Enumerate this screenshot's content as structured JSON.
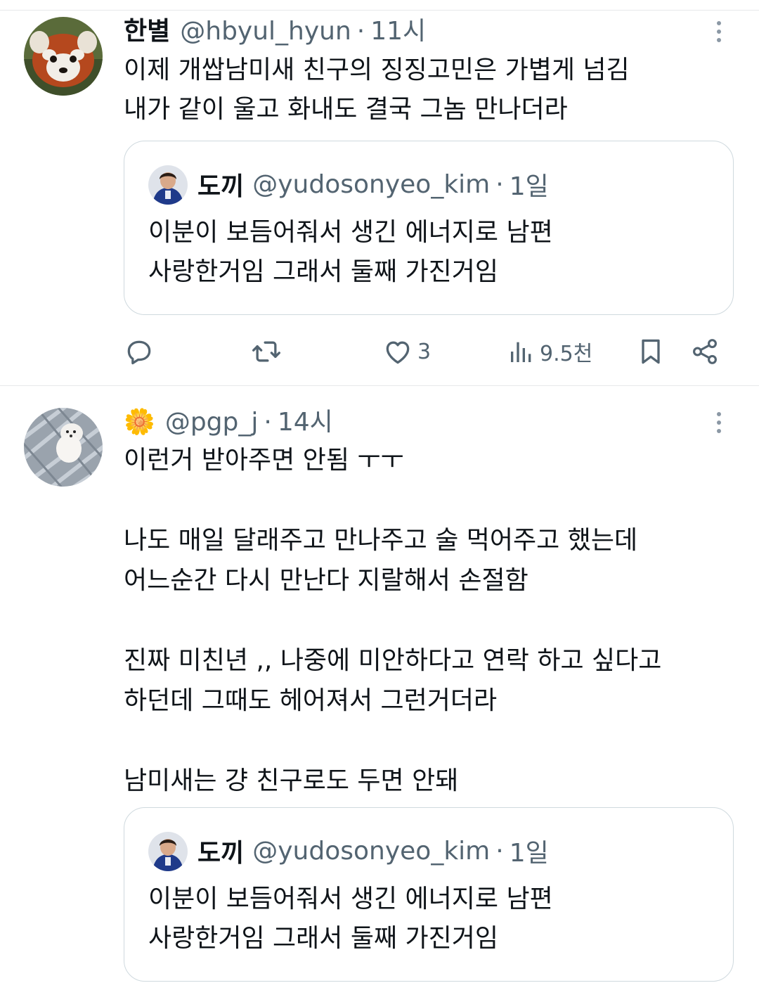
{
  "tweets": [
    {
      "display_name": "한별",
      "handle": "@hbyul_hyun",
      "separator": "·",
      "time": "11시",
      "text": "이제 개쌉남미새 친구의 징징고민은 가볍게 넘김\n내가 같이 울고 화내도 결국 그놈 만나더라",
      "quote": {
        "display_name": "도끼",
        "handle": "@yudosonyeo_kim",
        "separator": "·",
        "time": "1일",
        "text": "이분이 보듬어줘서 생긴 에너지로 남편\n사랑한거임 그래서 둘째 가진거임"
      },
      "actions": {
        "reply_icon": "reply-icon",
        "retweet_icon": "retweet-icon",
        "like_icon": "heart-icon",
        "like_count": "3",
        "views_icon": "views-icon",
        "views_count": "9.5천",
        "bookmark_icon": "bookmark-icon",
        "share_icon": "share-icon"
      }
    },
    {
      "display_name_emoji": "🌼",
      "handle": "@pgp_j",
      "separator": "·",
      "time": "14시",
      "text": "이런거 받아주면 안됨 ㅜㅜ\n\n나도 매일 달래주고 만나주고 술 먹어주고 했는데\n어느순간 다시 만난다 지랄해서 손절함\n\n진짜 미친년 ,, 나중에 미안하다고 연락 하고 싶다고\n하던데 그때도 헤어져서 그런거더라\n\n남미새는 걍 친구로도 두면 안돼",
      "quote": {
        "display_name": "도끼",
        "handle": "@yudosonyeo_kim",
        "separator": "·",
        "time": "1일",
        "text": "이분이 보듬어줘서 생긴 에너지로 남편\n사랑한거임 그래서 둘째 가진거임"
      }
    }
  ],
  "colors": {
    "text_primary": "#0f1419",
    "text_secondary": "#536471",
    "border": "#cfd9de",
    "divider": "#e6e8ea"
  }
}
